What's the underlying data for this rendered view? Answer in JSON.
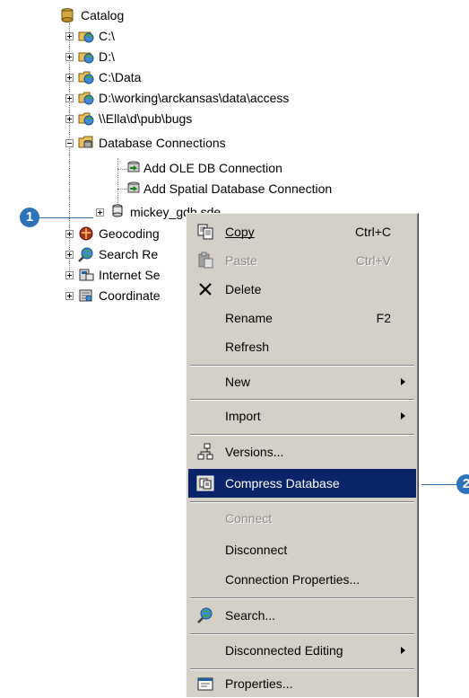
{
  "tree": {
    "root": "Catalog",
    "items": [
      {
        "label": "C:\\",
        "icon": "connected-drive-icon"
      },
      {
        "label": "D:\\",
        "icon": "connected-drive-icon"
      },
      {
        "label": "C:\\Data",
        "icon": "connected-folder-icon"
      },
      {
        "label": "D:\\working\\arckansas\\data\\access",
        "icon": "connected-folder-icon"
      },
      {
        "label": "\\\\Ella\\d\\pub\\bugs",
        "icon": "connected-folder-icon"
      },
      {
        "label": "Database Connections",
        "icon": "database-connections-icon"
      },
      {
        "label": "Add OLE DB Connection",
        "icon": "add-connection-icon"
      },
      {
        "label": "Add Spatial Database Connection",
        "icon": "add-connection-icon"
      },
      {
        "label": "mickey_gdb.sde",
        "icon": "sde-database-icon"
      },
      {
        "label": "Geocoding",
        "icon": "geocoding-icon"
      },
      {
        "label": "Search Re",
        "icon": "search-results-icon"
      },
      {
        "label": "Internet Se",
        "icon": "internet-servers-icon"
      },
      {
        "label": "Coordinate",
        "icon": "coordinate-systems-icon"
      }
    ]
  },
  "callouts": {
    "one": "1",
    "two": "2"
  },
  "menu": {
    "copy": {
      "label": "Copy",
      "underline": "C",
      "shortcut": "Ctrl+C",
      "icon": "copy-icon"
    },
    "paste": {
      "label": "Paste",
      "underline": "P",
      "shortcut": "Ctrl+V",
      "icon": "paste-icon"
    },
    "delete": {
      "label": "Delete",
      "underline": "D",
      "icon": "delete-x-icon"
    },
    "rename": {
      "label": "Rename",
      "shortcut": "F2"
    },
    "refresh": {
      "label": "Refresh"
    },
    "new": {
      "label": "New"
    },
    "import": {
      "label": "Import"
    },
    "versions": {
      "label": "Versions...",
      "icon": "versions-icon"
    },
    "compress": {
      "label": "Compress Database",
      "icon": "compress-database-icon"
    },
    "connect": {
      "label": "Connect"
    },
    "disconnect": {
      "label": "Disconnect"
    },
    "connection_properties": {
      "label": "Connection Properties..."
    },
    "search": {
      "label": "Search...",
      "icon": "search-icon"
    },
    "disconnected_editing": {
      "label": "Disconnected Editing"
    },
    "properties": {
      "label": "Properties...",
      "icon": "properties-icon"
    }
  },
  "colors": {
    "highlight": "#0a246a",
    "callout": "#2d73b9",
    "menu_bg": "#d4d0c8"
  }
}
